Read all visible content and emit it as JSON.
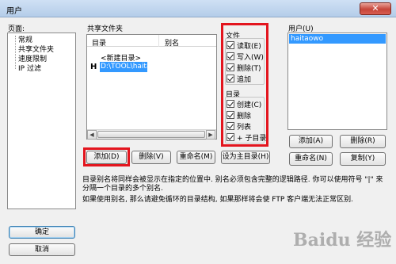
{
  "window": {
    "title": "用户",
    "close_glyph": "✕"
  },
  "page_panel": {
    "label": "页面:",
    "tree": [
      "常规",
      "共享文件夹",
      "速度限制",
      "IP 过滤"
    ]
  },
  "shared": {
    "label": "共享文件夹",
    "col_dir": "目录",
    "col_alias": "别名",
    "new_dir_item": "<新建目录>",
    "home_marker": "H",
    "path": "D:\\TOOL\\haitao",
    "scroll_left": "◀",
    "scroll_right": "▶"
  },
  "buttons": {
    "add": "添加(D)",
    "delete": "删除(V)",
    "rename": "重命名(M)",
    "set_home": "设为主目录(H)",
    "ok": "确定",
    "cancel": "取消"
  },
  "file_perms": {
    "label": "文件",
    "items": [
      "读取(E)",
      "写入(W)",
      "删除(T)",
      "追加"
    ]
  },
  "dir_perms": {
    "label": "目录",
    "items": [
      "创建(C)",
      "删除",
      "列表",
      "+ 子目录"
    ]
  },
  "users": {
    "label": "用户(U)",
    "items": [
      "haitaowo"
    ],
    "add": "添加(A)",
    "delete": "删除(R)",
    "rename": "重命名(N)",
    "copy": "复制(Y)"
  },
  "help": {
    "para1": "目录别名将同样会被显示在指定的位置中. 别名必须包含完整的逻辑路径. 你可以使用符号 \"|\" 来分隔一个目录的多个别名.",
    "para2": "如果使用别名, 那么请避免循环的目录结构, 如果那样将会使 FTP 客户端无法正常区别."
  },
  "watermark": "Baidu 经验"
}
